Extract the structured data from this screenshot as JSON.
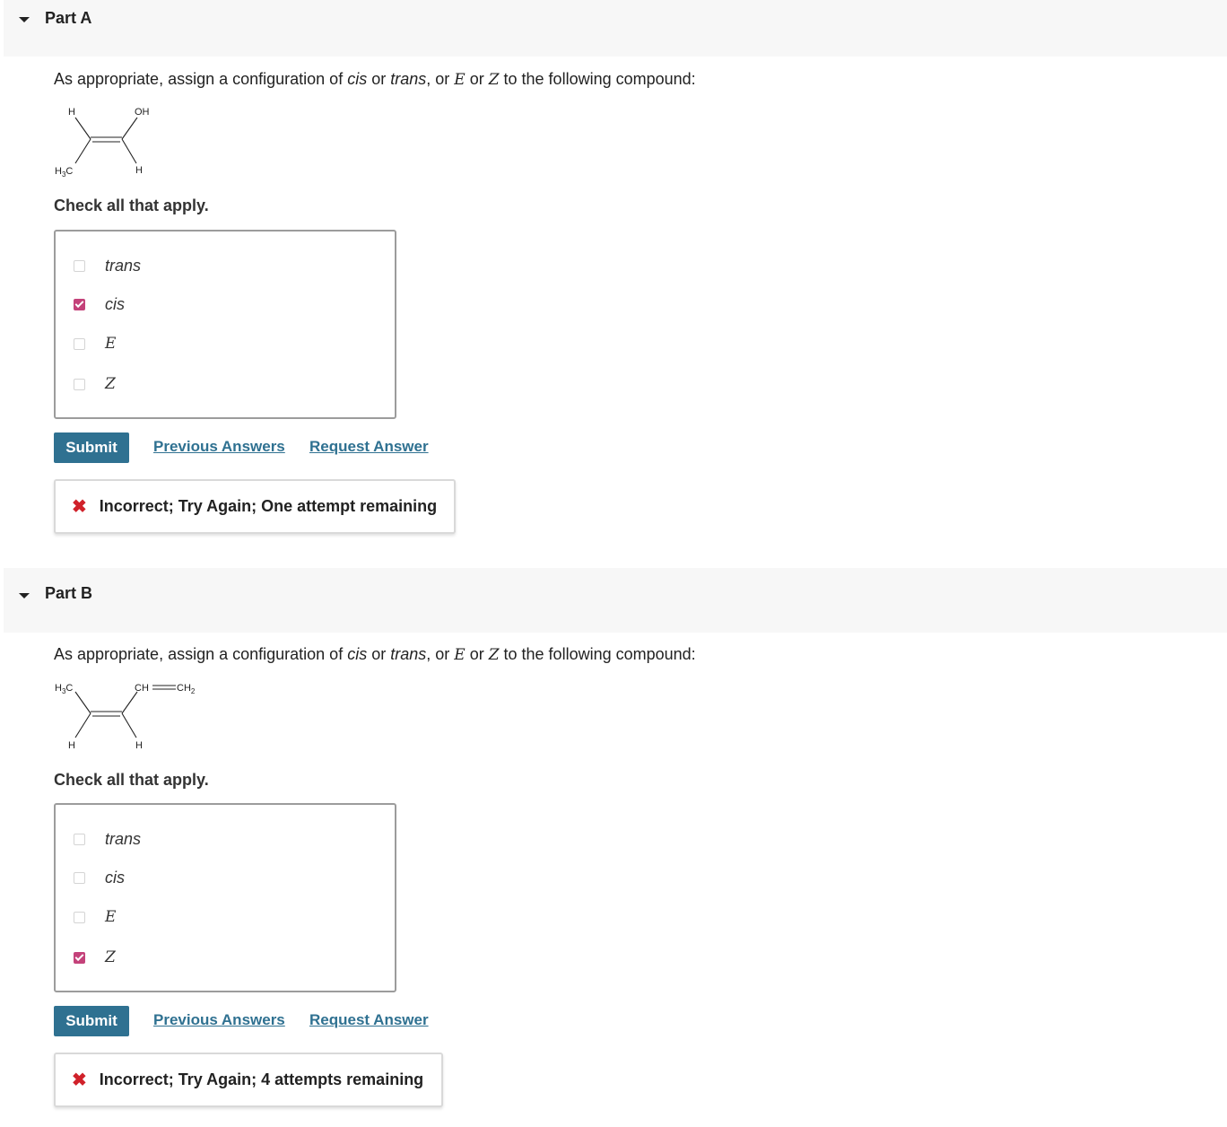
{
  "parts": [
    {
      "title": "Part A",
      "prompt": {
        "before": "As appropriate, assign a configuration of ",
        "cis": "cis",
        "or1": " or ",
        "trans": "trans",
        "or2": ", or ",
        "E": "E",
        "or3": " or ",
        "Z": "Z",
        "after": " to the following compound:"
      },
      "molecule": {
        "top_left": "H",
        "top_right": "OH",
        "bottom_left_main": "H",
        "bottom_left_sub": "3",
        "bottom_left_tail": "C",
        "bottom_right": "H"
      },
      "check_note": "Check all that apply.",
      "options": [
        {
          "label": "trans",
          "checked": false
        },
        {
          "label": "cis",
          "checked": true
        },
        {
          "label": "E",
          "checked": false
        },
        {
          "label": "Z",
          "checked": false
        }
      ],
      "submit_label": "Submit",
      "previous_answers": "Previous Answers",
      "request_answer": "Request Answer",
      "feedback": "Incorrect; Try Again; One attempt remaining"
    },
    {
      "title": "Part B",
      "prompt": {
        "before": "As appropriate, assign a configuration of ",
        "cis": "cis",
        "or1": " or ",
        "trans": "trans",
        "or2": ", or ",
        "E": "E",
        "or3": " or ",
        "Z": "Z",
        "after": " to the following compound:"
      },
      "molecule": {
        "top_left_main": "H",
        "top_left_sub": "3",
        "top_left_tail": "C",
        "top_right_a": "CH",
        "top_right_b": "CH",
        "top_right_sub": "2",
        "bottom_left": "H",
        "bottom_right": "H"
      },
      "check_note": "Check all that apply.",
      "options": [
        {
          "label": "trans",
          "checked": false
        },
        {
          "label": "cis",
          "checked": false
        },
        {
          "label": "E",
          "checked": false
        },
        {
          "label": "Z",
          "checked": true
        }
      ],
      "submit_label": "Submit",
      "previous_answers": "Previous Answers",
      "request_answer": "Request Answer",
      "feedback": "Incorrect; Try Again; 4 attempts remaining"
    }
  ],
  "colors": {
    "header_bg": "#f7f7f7",
    "button_bg": "#2f7191",
    "link": "#2f7191",
    "check": "#c4427a",
    "error": "#d0212a"
  }
}
